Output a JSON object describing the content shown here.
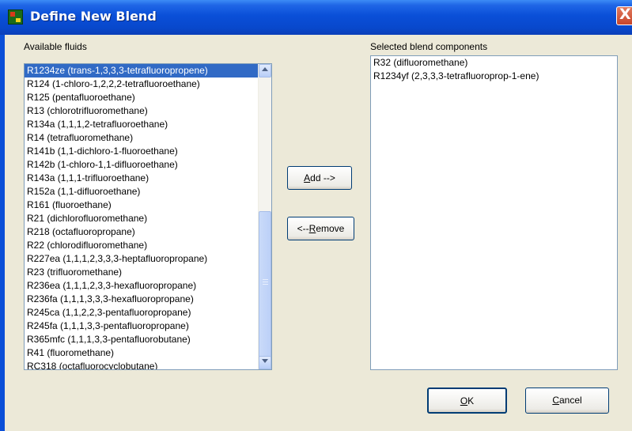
{
  "window": {
    "title": "Define New Blend",
    "close_label": "X"
  },
  "available": {
    "label": "Available fluids",
    "items": [
      "R1234ze (trans-1,3,3,3-tetrafluoropropene)",
      "R124 (1-chloro-1,2,2,2-tetrafluoroethane)",
      "R125 (pentafluoroethane)",
      "R13 (chlorotrifluoromethane)",
      "R134a (1,1,1,2-tetrafluoroethane)",
      "R14 (tetrafluoromethane)",
      "R141b (1,1-dichloro-1-fluoroethane)",
      "R142b (1-chloro-1,1-difluoroethane)",
      "R143a (1,1,1-trifluoroethane)",
      "R152a (1,1-difluoroethane)",
      "R161 (fluoroethane)",
      "R21 (dichlorofluoromethane)",
      "R218 (octafluoropropane)",
      "R22 (chlorodifluoromethane)",
      "R227ea (1,1,1,2,3,3,3-heptafluoropropane)",
      "R23 (trifluoromethane)",
      "R236ea (1,1,1,2,3,3-hexafluoropropane)",
      "R236fa (1,1,1,3,3,3-hexafluoropropane)",
      "R245ca (1,1,2,2,3-pentafluoropropane)",
      "R245fa (1,1,1,3,3-pentafluoropropane)",
      "R365mfc (1,1,1,3,3-pentafluorobutane)",
      "R41 (fluoromethane)",
      "RC318 (octafluorocyclobutane)"
    ],
    "selected_index": 0
  },
  "selected": {
    "label": "Selected blend components",
    "items": [
      "R32 (difluoromethane)",
      "R1234yf (2,3,3,3-tetrafluoroprop-1-ene)"
    ]
  },
  "buttons": {
    "add": {
      "accel": "A",
      "rest": "dd -->"
    },
    "remove": {
      "pre": "<-- ",
      "accel": "R",
      "rest": "emove"
    },
    "ok": {
      "accel": "O",
      "rest": "K"
    },
    "cancel": {
      "accel": "C",
      "rest": "ancel"
    }
  },
  "colors": {
    "title_bar": "#0a4fd8",
    "selection": "#316ac5",
    "dialog_bg": "#ece9d8"
  }
}
